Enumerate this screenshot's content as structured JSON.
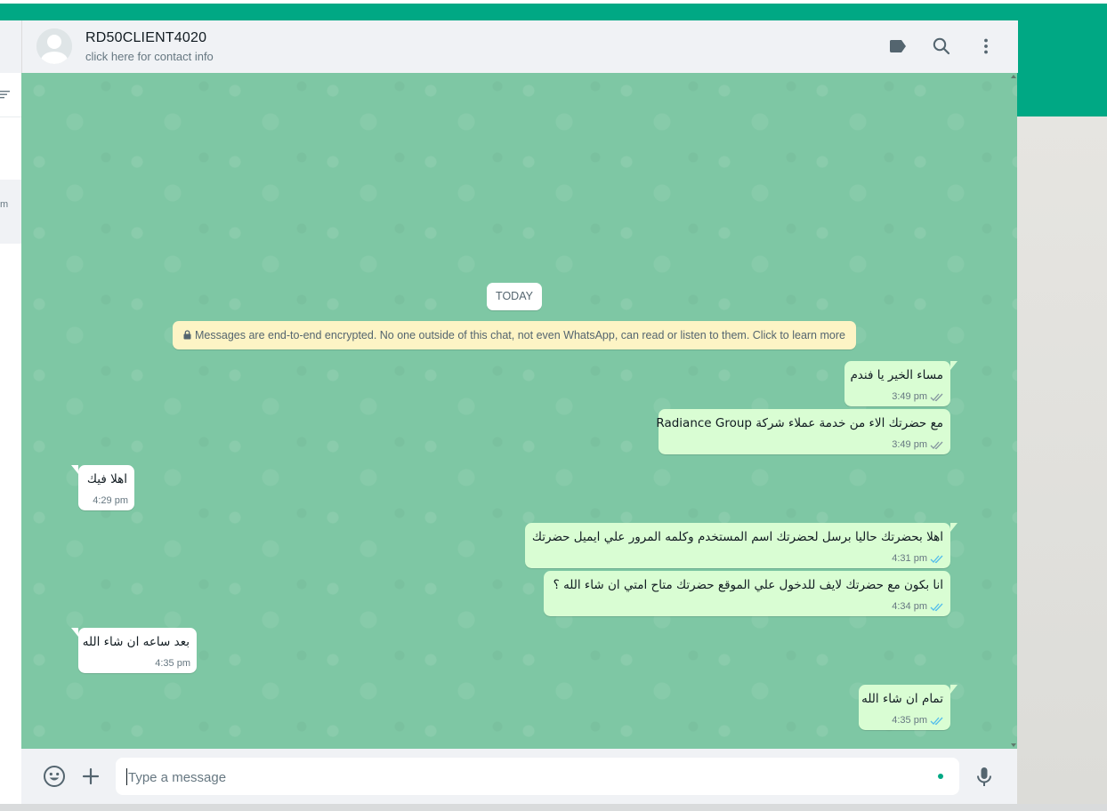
{
  "header": {
    "contact_name": "RD50CLIENT4020",
    "contact_sub": "click here for contact info"
  },
  "left_pane": {
    "selected_chat_fragment": "m"
  },
  "icons": {
    "avatar": "default-avatar-icon",
    "labels": "label-tag-icon",
    "search": "search-icon",
    "menu": "kebab-menu-icon",
    "filter": "filter-icon",
    "lock": "lock-icon",
    "emoji": "emoji-icon",
    "attach": "plus-icon",
    "mic": "microphone-icon"
  },
  "colors": {
    "brand": "#00a884",
    "outgoing_bubble": "#d9fdd3",
    "incoming_bubble": "#ffffff",
    "read_tick": "#53bdeb",
    "sent_tick": "#8696a0"
  },
  "chat": {
    "date_chip": "TODAY",
    "encryption_notice": "Messages are end-to-end encrypted. No one outside of this chat, not even WhatsApp, can read or listen to them. Click to learn more",
    "messages": [
      {
        "direction": "out",
        "text": "مساء الخير يا فندم",
        "time": "3:49 pm",
        "status": "delivered"
      },
      {
        "direction": "out",
        "text": "مع حضرتك الاء من خدمة عملاء شركة Radiance Group",
        "time": "3:49 pm",
        "status": "delivered"
      },
      {
        "direction": "in",
        "text": "اهلا فيك",
        "time": "4:29 pm"
      },
      {
        "direction": "out",
        "text": "اهلا بحضرتك حاليا برسل لحضرتك اسم المستخدم وكلمه المرور علي ايميل حضرتك",
        "time": "4:31 pm",
        "status": "read"
      },
      {
        "direction": "out",
        "text": "انا بكون مع حضرتك لايف للدخول علي الموقع حضرتك متاح امتي ان شاء الله ؟",
        "time": "4:34 pm",
        "status": "read"
      },
      {
        "direction": "in",
        "text": "بعد ساعه ان شاء الله",
        "time": "4:35 pm"
      },
      {
        "direction": "out",
        "text": "تمام ان شاء الله",
        "time": "4:35 pm",
        "status": "read"
      }
    ]
  },
  "compose": {
    "placeholder": "Type a message",
    "value": ""
  }
}
